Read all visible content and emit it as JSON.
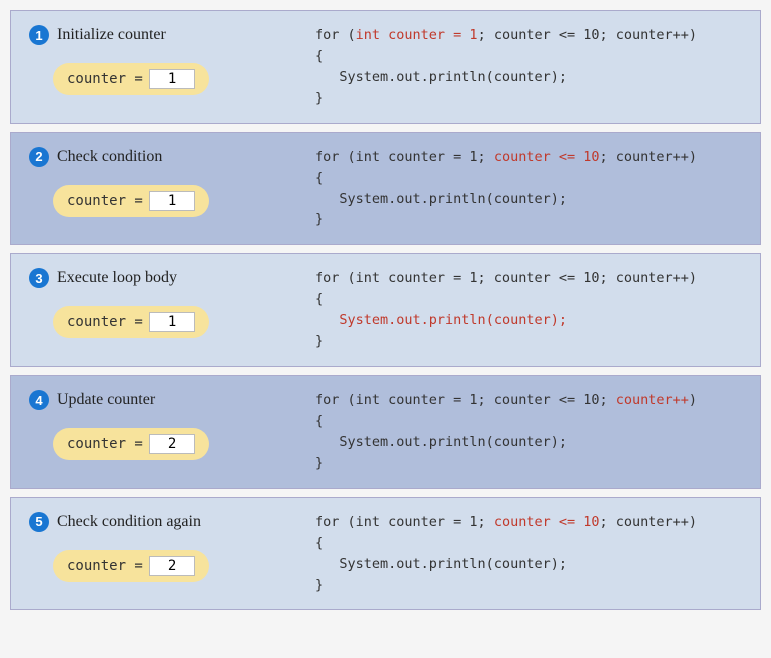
{
  "counter_label": "counter =",
  "steps": [
    {
      "num": "1",
      "title": "Initialize counter",
      "counter_value": "1",
      "alt": false,
      "code": [
        {
          "t": "for (",
          "h": false
        },
        {
          "t": "int counter = 1",
          "h": true
        },
        {
          "t": "; counter <= 10; counter++)",
          "h": false
        },
        {
          "nl": true
        },
        {
          "t": "{",
          "h": false
        },
        {
          "nl": true
        },
        {
          "t": "   System.out.println(counter);",
          "h": false
        },
        {
          "nl": true
        },
        {
          "t": "}",
          "h": false
        }
      ]
    },
    {
      "num": "2",
      "title": "Check condition",
      "counter_value": "1",
      "alt": true,
      "code": [
        {
          "t": "for (int counter = 1; ",
          "h": false
        },
        {
          "t": "counter <= 10",
          "h": true
        },
        {
          "t": "; counter++)",
          "h": false
        },
        {
          "nl": true
        },
        {
          "t": "{",
          "h": false
        },
        {
          "nl": true
        },
        {
          "t": "   System.out.println(counter);",
          "h": false
        },
        {
          "nl": true
        },
        {
          "t": "}",
          "h": false
        }
      ]
    },
    {
      "num": "3",
      "title": "Execute loop body",
      "counter_value": "1",
      "alt": false,
      "code": [
        {
          "t": "for (int counter = 1; counter <= 10; counter++)",
          "h": false
        },
        {
          "nl": true
        },
        {
          "t": "{",
          "h": false
        },
        {
          "nl": true
        },
        {
          "t": "   ",
          "h": false
        },
        {
          "t": "System.out.println(counter);",
          "h": true
        },
        {
          "nl": true
        },
        {
          "t": "}",
          "h": false
        }
      ]
    },
    {
      "num": "4",
      "title": "Update counter",
      "counter_value": "2",
      "alt": true,
      "code": [
        {
          "t": "for (int counter = 1; counter <= 10; ",
          "h": false
        },
        {
          "t": "counter++",
          "h": true
        },
        {
          "t": ")",
          "h": false
        },
        {
          "nl": true
        },
        {
          "t": "{",
          "h": false
        },
        {
          "nl": true
        },
        {
          "t": "   System.out.println(counter);",
          "h": false
        },
        {
          "nl": true
        },
        {
          "t": "}",
          "h": false
        }
      ]
    },
    {
      "num": "5",
      "title": "Check condition again",
      "counter_value": "2",
      "alt": false,
      "code": [
        {
          "t": "for (int counter = 1; ",
          "h": false
        },
        {
          "t": "counter <= 10",
          "h": true
        },
        {
          "t": "; counter++)",
          "h": false
        },
        {
          "nl": true
        },
        {
          "t": "{",
          "h": false
        },
        {
          "nl": true
        },
        {
          "t": "   System.out.println(counter);",
          "h": false
        },
        {
          "nl": true
        },
        {
          "t": "}",
          "h": false
        }
      ]
    }
  ]
}
